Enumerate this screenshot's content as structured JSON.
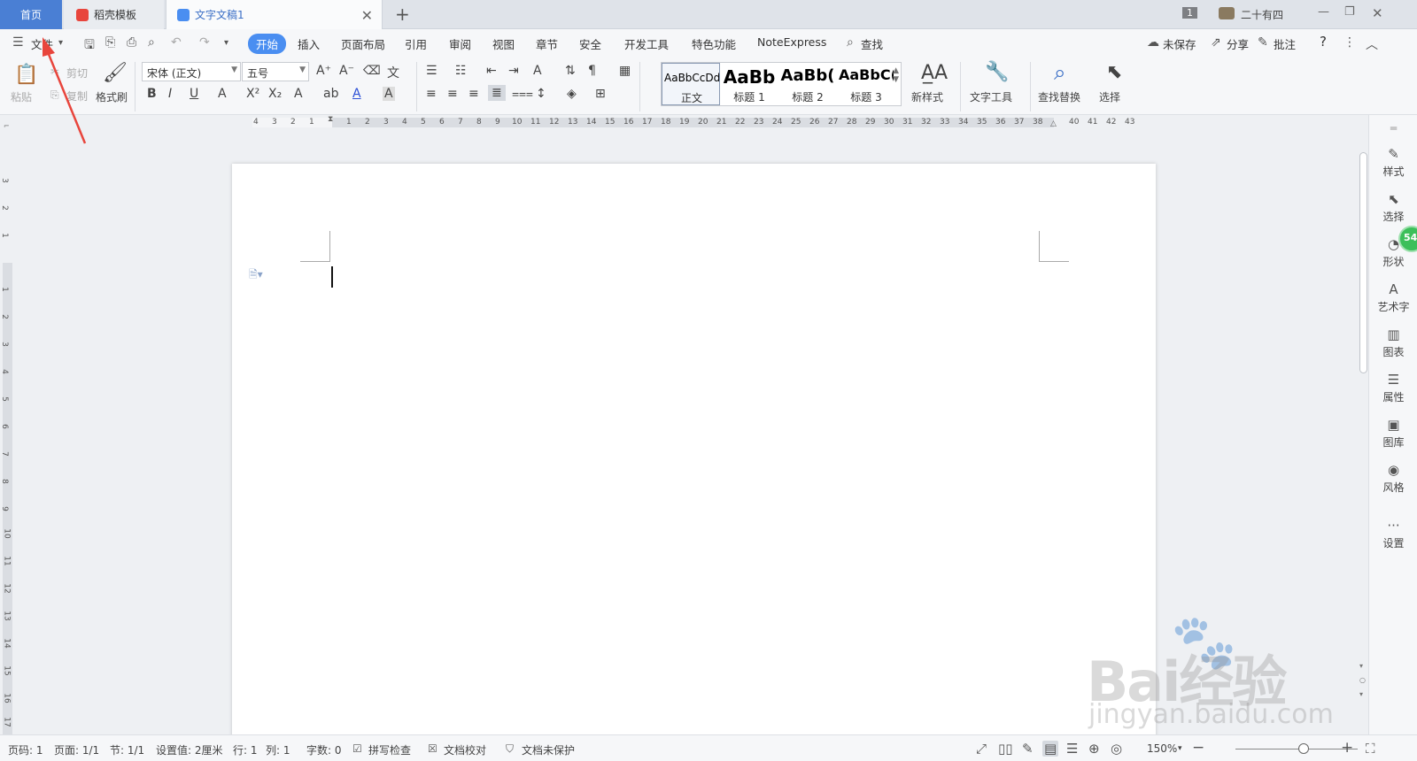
{
  "tabs": {
    "home": "首页",
    "template": "稻壳模板",
    "document": "文字文稿1",
    "page_badge": "1",
    "user": "二十有四"
  },
  "toolbar": {
    "menu_file": "文件",
    "tabs": [
      "开始",
      "插入",
      "页面布局",
      "引用",
      "审阅",
      "视图",
      "章节",
      "安全",
      "开发工具",
      "特色功能",
      "NoteExpress",
      "查找"
    ],
    "active_tab": "开始",
    "unsaved": "未保存",
    "share": "分享",
    "comment": "批注",
    "help": "?"
  },
  "ribbon": {
    "paste": "粘贴",
    "cut": "剪切",
    "copy": "复制",
    "format_painter": "格式刷",
    "font_name": "宋体 (正文)",
    "font_size": "五号",
    "styles": [
      {
        "preview": "AaBbCcDd",
        "name": "正文"
      },
      {
        "preview": "AaBb",
        "name": "标题 1"
      },
      {
        "preview": "AaBb(",
        "name": "标题 2"
      },
      {
        "preview": "AaBbC(",
        "name": "标题 3"
      }
    ],
    "new_style": "新样式",
    "text_tools": "文字工具",
    "find_replace": "查找替换",
    "select": "选择"
  },
  "ruler": {
    "horizontal": [
      "4",
      "3",
      "2",
      "1",
      "1",
      "2",
      "3",
      "4",
      "5",
      "6",
      "7",
      "8",
      "9",
      "10",
      "11",
      "12",
      "13",
      "14",
      "15",
      "16",
      "17",
      "18",
      "19",
      "20",
      "21",
      "22",
      "23",
      "24",
      "25",
      "26",
      "27",
      "28",
      "29",
      "30",
      "31",
      "32",
      "33",
      "34",
      "35",
      "36",
      "37",
      "38",
      "40",
      "41",
      "42",
      "43"
    ],
    "vertical": [
      "3",
      "2",
      "1",
      "1",
      "2",
      "3",
      "4",
      "5",
      "6",
      "7",
      "8",
      "9",
      "10",
      "11",
      "12",
      "13",
      "14",
      "15",
      "16",
      "17"
    ]
  },
  "side_panel": [
    "样式",
    "选择",
    "形状",
    "艺术字",
    "图表",
    "属性",
    "图库",
    "风格",
    "设置"
  ],
  "side_badge": "54",
  "status": {
    "page": "页码: 1",
    "pages": "页面: 1/1",
    "section": "节: 1/1",
    "setting": "设置值: 2厘米",
    "row": "行: 1",
    "col": "列: 1",
    "words": "字数: 0",
    "spell": "拼写检查",
    "proof": "文档校对",
    "protect": "文档未保护",
    "zoom": "150%"
  },
  "watermark": {
    "brand": "Bai经验",
    "url": "jingyan.baidu.com"
  },
  "colors": {
    "accent": "#4a8ef1",
    "home_tab": "#4a7fd4",
    "arrow": "#e8453c",
    "badge": "#3cbf5a"
  }
}
